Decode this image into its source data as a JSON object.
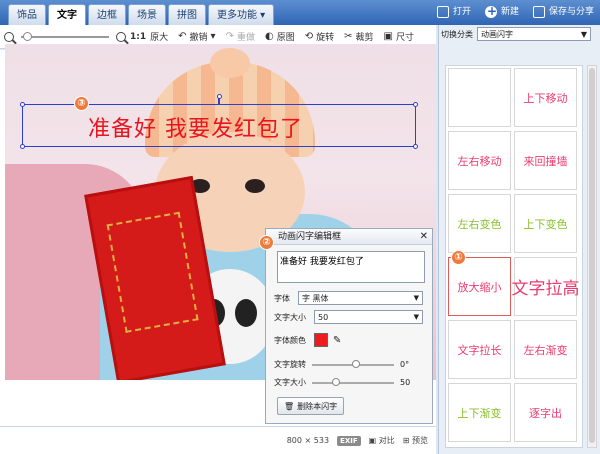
{
  "tabs": [
    {
      "label": "饰品",
      "active": false
    },
    {
      "label": "文字",
      "active": true
    },
    {
      "label": "边框",
      "active": false
    },
    {
      "label": "场景",
      "active": false
    },
    {
      "label": "拼图",
      "active": false
    },
    {
      "label": "更多功能 ▾",
      "active": false
    }
  ],
  "topright": {
    "open": "打开",
    "new": "新建",
    "save_share": "保存与分享"
  },
  "toolbar": {
    "ratio": "1:1",
    "original_size": "原大",
    "undo": "撤销",
    "redo": "重做",
    "original_image": "原图",
    "rotate": "旋转",
    "crop": "裁剪",
    "size": "尺寸"
  },
  "canvas": {
    "flash_text": "准备好 我要发红包了"
  },
  "badges": {
    "one": "①",
    "two": "②",
    "three": "③"
  },
  "editor": {
    "title": "动画闪字编辑框",
    "text_value": "准备好 我要发红包了",
    "font_label": "字体",
    "font_value": "黑体",
    "font_glyph": "字",
    "size_label": "文字大小",
    "size_value": "50",
    "color_label": "字体颜色",
    "color_value": "#ee1c1c",
    "rotate_label": "文字旋转",
    "rotate_value": "0°",
    "size2_label": "文字大小",
    "size2_value": "50",
    "delete_label": "删除本闪字"
  },
  "status": {
    "width": "800",
    "times": "×",
    "height": "533",
    "exif": "EXIF",
    "compare": "对比",
    "preview": "预览"
  },
  "right": {
    "switch_label": "切换分类",
    "category": "动画闪字",
    "items": [
      {
        "label": "",
        "color": "#ffffff"
      },
      {
        "label": "上下移动",
        "color": "#ee3a6e"
      },
      {
        "label": "左右移动",
        "color": "#ee3a6e"
      },
      {
        "label": "来回撞墙",
        "color": "#ee3a6e"
      },
      {
        "label": "左右变色",
        "color": "#8bbf2c"
      },
      {
        "label": "上下变色",
        "color": "#8bbf2c"
      },
      {
        "label": "放大缩小",
        "color": "#ee3a6e"
      },
      {
        "label": "文字拉高",
        "color": "#ee3a6e"
      },
      {
        "label": "文字拉长",
        "color": "#ee3a6e"
      },
      {
        "label": "左右渐变",
        "color": "#ee3a6e"
      },
      {
        "label": "上下渐变",
        "color": "#8bbf2c"
      },
      {
        "label": "逐字出",
        "color": "#ee3a6e"
      }
    ]
  }
}
